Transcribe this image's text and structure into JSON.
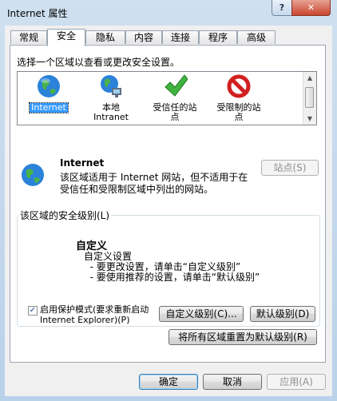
{
  "window": {
    "title": "Internet 属性",
    "help_label": "?",
    "close_label": "✕"
  },
  "tabs": [
    {
      "label": "常规"
    },
    {
      "label": "安全"
    },
    {
      "label": "隐私"
    },
    {
      "label": "内容"
    },
    {
      "label": "连接"
    },
    {
      "label": "程序"
    },
    {
      "label": "高级"
    }
  ],
  "security": {
    "prompt": "选择一个区域以查看或更改安全设置。",
    "zones": [
      {
        "label": "Internet",
        "icon": "globe-icon",
        "selected": true
      },
      {
        "label": "本地\nIntranet",
        "icon": "intranet-globe-icon"
      },
      {
        "label": "受信任的站\n点",
        "icon": "green-check-icon"
      },
      {
        "label": "受限制的站\n点",
        "icon": "red-prohibited-icon"
      }
    ],
    "zone_name": "Internet",
    "zone_desc": "该区域适用于 Internet 网站，但不适用于在\n受信任和受限制区域中列出的网站。",
    "sites_button": "站点(S)",
    "level_group_title": "该区域的安全级别(L)",
    "level_name": "自定义",
    "level_lines": "自定义设置\n  - 要更改设置，请单击“自定义级别”\n  - 要使用推荐的设置，请单击“默认级别”",
    "protected_mode_label": "启用保护模式(要求重新启动\nInternet Explorer)(P)",
    "protected_mode_checked": true,
    "custom_level_button": "自定义级别(C)...",
    "default_level_button": "默认级别(D)",
    "reset_all_button": "将所有区域重置为默认级别(R)"
  },
  "footer": {
    "ok": "确定",
    "cancel": "取消",
    "apply": "应用(A)"
  }
}
